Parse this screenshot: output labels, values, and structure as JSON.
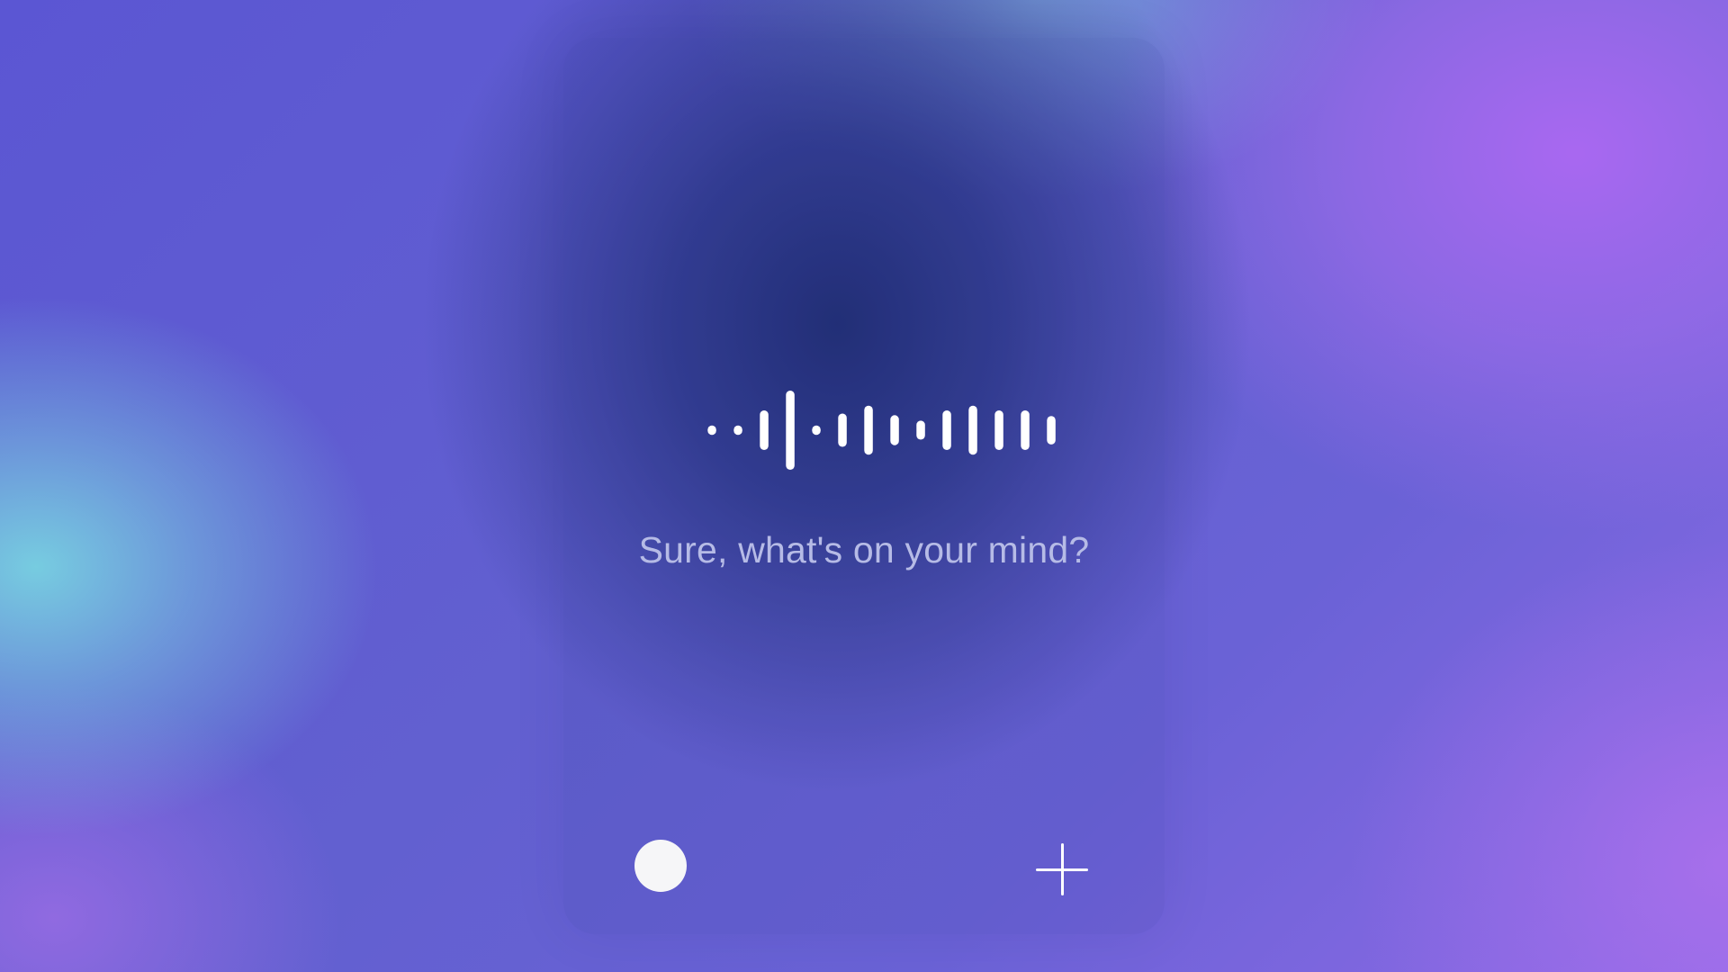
{
  "assistant": {
    "prompt": "Sure, what's on your mind?",
    "state": "listening",
    "waveform_levels": [
      0.12,
      0.12,
      0.5,
      1.0,
      0.12,
      0.42,
      0.62,
      0.38,
      0.24,
      0.5,
      0.62,
      0.5,
      0.5,
      0.36
    ]
  },
  "controls": {
    "record_button": {
      "icon": "record-dot-icon"
    },
    "add_button": {
      "icon": "plus-icon"
    }
  },
  "colors": {
    "waveform": "#ffffff",
    "prompt_text": "#b6bbe6",
    "record_dot": "#f6f6f8",
    "background_center": "#23327d",
    "background_accent_purple": "#ac68f2",
    "background_accent_cyan": "#78d2e1"
  }
}
